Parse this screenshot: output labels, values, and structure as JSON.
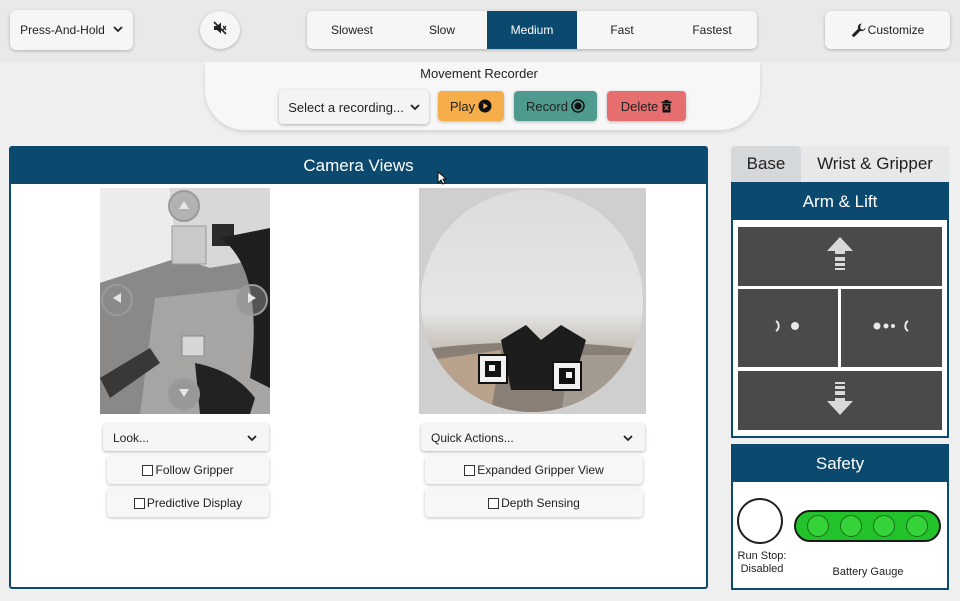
{
  "topbar": {
    "mode_label": "Press-And-Hold",
    "speeds": [
      "Slowest",
      "Slow",
      "Medium",
      "Fast",
      "Fastest"
    ],
    "active_speed": "Medium",
    "customize_label": "Customize"
  },
  "recorder": {
    "title": "Movement Recorder",
    "select_placeholder": "Select a recording...",
    "play_label": "Play",
    "record_label": "Record",
    "delete_label": "Delete"
  },
  "camera": {
    "title": "Camera Views",
    "look_label": "Look...",
    "quick_actions_label": "Quick Actions...",
    "follow_gripper_label": "Follow Gripper",
    "predictive_display_label": "Predictive Display",
    "expanded_gripper_label": "Expanded Gripper View",
    "depth_sensing_label": "Depth Sensing"
  },
  "tabs": {
    "base_label": "Base",
    "wrist_label": "Wrist & Gripper"
  },
  "arm": {
    "title": "Arm & Lift"
  },
  "safety": {
    "title": "Safety",
    "runstop_label": "Run Stop: Disabled",
    "battery_label": "Battery Gauge",
    "battery_color": "#22c22a"
  },
  "colors": {
    "accent": "#0b4a6e",
    "play": "#f5ae4a",
    "record": "#4e9a8e",
    "delete": "#e66e6e"
  }
}
